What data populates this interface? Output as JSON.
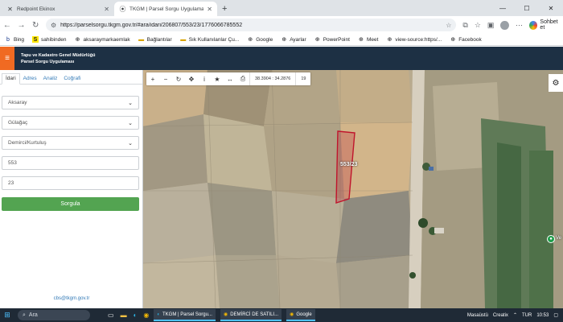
{
  "browser": {
    "tabs": [
      {
        "title": "Redpoint Ekinox",
        "active": false
      },
      {
        "title": "TKGM | Parsel Sorgu Uygulaması",
        "active": true
      }
    ],
    "url": "https://parselsorgu.tkgm.gov.tr/#ara/idari/206807/553/23/1776066785552",
    "profile_label": "Sohbet et",
    "bookmarks": [
      "Bing",
      "sahibinden",
      "aksaraymarkaemlak",
      "Bağlantılar",
      "Sık Kullanılanlar Çu...",
      "Google",
      "Ayarlar",
      "PowerPoint",
      "Meet",
      "view-source:https/...",
      "Facebook"
    ]
  },
  "app": {
    "title_line1": "Tapu ve Kadastro Genel Müdürlüğü",
    "title_line2": "Parsel Sorgu Uygulaması"
  },
  "left_panel": {
    "tabs": [
      "İdari",
      "Adres",
      "Analiz",
      "Coğrafi"
    ],
    "active_tab": "İdari",
    "fields": {
      "il": "Aksaray",
      "ilce": "Gülağaç",
      "mahalle": "Demirci/Kurtuluş",
      "ada": "553",
      "parsel": "23"
    },
    "submit_label": "Sorgula",
    "footer_email": "cbs@tkgm.gov.tr"
  },
  "map": {
    "coordinates": "38.3904 : 34.2876",
    "zoom_level": "19",
    "parcel_label": "553/23",
    "poi_label": "Ve",
    "tools": [
      "plus-icon",
      "minus-icon",
      "refresh-icon",
      "locate-icon",
      "info-icon",
      "star-icon",
      "measure-icon",
      "print-icon"
    ]
  },
  "taskbar": {
    "search_placeholder": "Ara",
    "running_app_1": "TKGM | Parsel Sorgu...",
    "running_app_2": "DEMİRCİ DE SATILI...",
    "running_app_3": "Google",
    "desktop_label": "Masaüstü",
    "creatix_label": "Creatix",
    "lang": "TUR",
    "time": "10:53"
  },
  "colors": {
    "app_header": "#1d3044",
    "hamburger": "#f06a22",
    "submit": "#53a451",
    "parcel_outline": "#c0142c"
  }
}
